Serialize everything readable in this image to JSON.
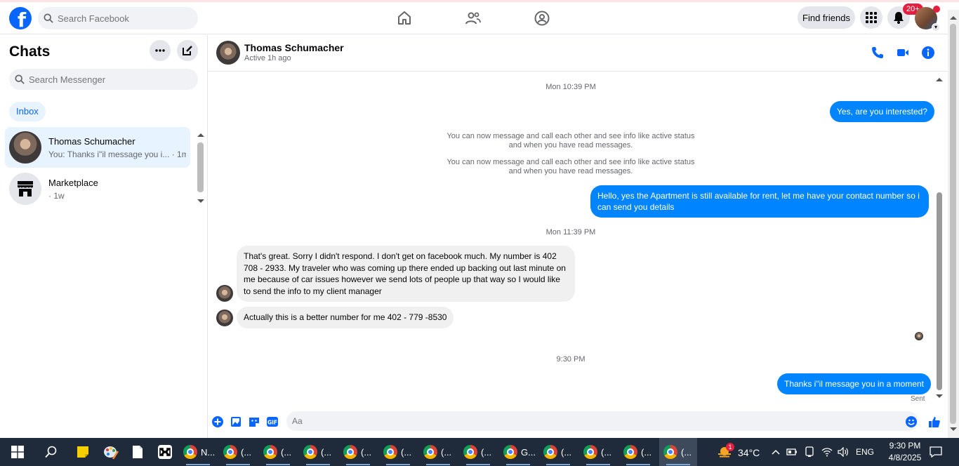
{
  "topbar": {
    "logo": "f",
    "search_placeholder": "Search Facebook",
    "find_friends": "Find friends",
    "notification_badge": "20+"
  },
  "sidebar": {
    "title": "Chats",
    "search_placeholder": "Search Messenger",
    "inbox_label": "Inbox",
    "chats": [
      {
        "name": "Thomas Schumacher",
        "preview": "You: Thanks i\"il message you i... · 1m"
      },
      {
        "name": "Marketplace",
        "preview": "· 1w"
      }
    ]
  },
  "conversation": {
    "name": "Thomas Schumacher",
    "status": "Active 1h ago",
    "timestamps": [
      "Mon 10:39 PM",
      "Mon 11:39 PM",
      "9:30 PM"
    ],
    "system_messages": [
      "You can now message and call each other and see info like active status and when you have read messages.",
      "You can now message and call each other and see info like active status and when you have read messages."
    ],
    "messages": [
      {
        "from": "me",
        "text": "Yes, are you interested?"
      },
      {
        "from": "me",
        "text": "Hello, yes the Apartment is still available for rent, let me have your contact number so i can send you details"
      },
      {
        "from": "them",
        "text": "That's great. Sorry I didn't respond. I don't get on facebook much. My number is 402 708 - 2933. My traveler who was coming up there ended up backing out last minute on me because of car issues however we send lots of people up that way so I would like to send the info to my client manager"
      },
      {
        "from": "them",
        "text": "Actually this is a better number for me 402 - 779 -8530"
      },
      {
        "from": "me",
        "text": "Thanks i\"il message you in a moment"
      }
    ],
    "sent_label": "Sent",
    "composer_placeholder": "Aa"
  },
  "taskbar": {
    "apps": [
      "N...",
      "(...",
      "(...",
      "(...",
      "(...",
      "(...",
      "(...",
      "(...",
      "G...",
      "(...",
      "(...",
      "(...",
      "(..."
    ],
    "weather_badge": "1",
    "temperature": "34°C",
    "language": "ENG",
    "time": "9:30 PM",
    "date": "4/8/2025"
  },
  "colors": {
    "accent": "#0866ff",
    "bubble_out": "#0084ff",
    "bubble_in": "#f0f0f0",
    "taskbar": "#1f2b3a"
  }
}
